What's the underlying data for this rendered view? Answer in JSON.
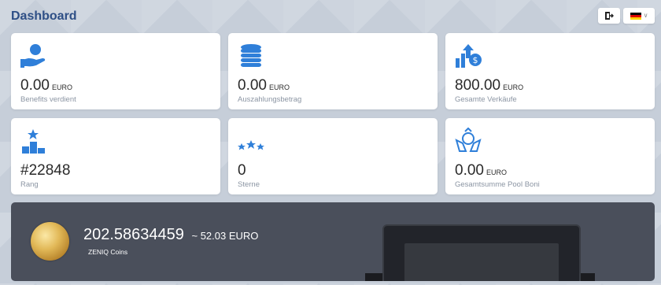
{
  "page": {
    "title": "Dashboard"
  },
  "header": {
    "language": "de"
  },
  "colors": {
    "icon_blue": "#2f7fd9",
    "title_blue": "#2e4f86",
    "banner_bg": "#4a4f5b"
  },
  "cards": [
    {
      "value": "0.00",
      "unit": "EURO",
      "label": "Benefits verdient",
      "icon": "user-hand-icon"
    },
    {
      "value": "0.00",
      "unit": "EURO",
      "label": "Auszahlungsbetrag",
      "icon": "coins-stack-icon"
    },
    {
      "value": "800.00",
      "unit": "EURO",
      "label": "Gesamte Verkäufe",
      "icon": "sales-up-icon"
    },
    {
      "value": "#22848",
      "unit": "",
      "label": "Rang",
      "icon": "podium-icon"
    },
    {
      "value": "0",
      "unit": "",
      "label": "Sterne",
      "icon": "stars-icon"
    },
    {
      "value": "0.00",
      "unit": "EURO",
      "label": "Gesamtsumme Pool Boni",
      "icon": "pool-hands-icon"
    }
  ],
  "zeniq": {
    "amount": "202.58634459",
    "approx": "~ 52.03 EURO",
    "coin_name": "ZENIQ Coins"
  }
}
